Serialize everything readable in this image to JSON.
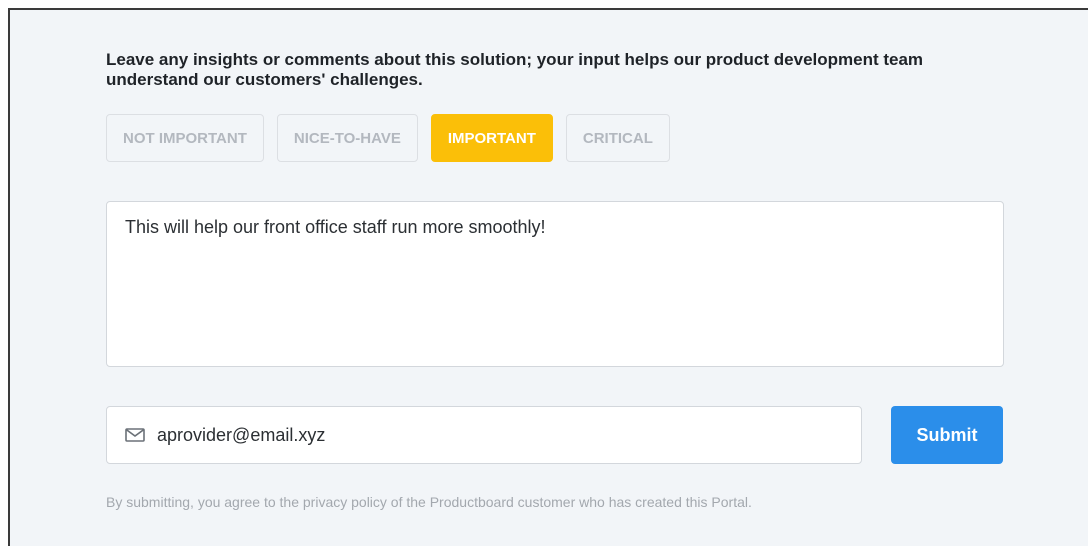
{
  "form": {
    "prompt": "Leave any insights or comments about this solution; your input helps our product development team understand our customers' challenges.",
    "importance_options": [
      {
        "label": "NOT IMPORTANT",
        "selected": false
      },
      {
        "label": "NICE-TO-HAVE",
        "selected": false
      },
      {
        "label": "IMPORTANT",
        "selected": true
      },
      {
        "label": "CRITICAL",
        "selected": false
      }
    ],
    "comment_value": "This will help our front office staff run more smoothly!",
    "email_value": "aprovider@email.xyz",
    "email_icon": "mail-icon",
    "submit_label": "Submit",
    "privacy_text": "By submitting, you agree to the privacy policy of the Productboard customer who has created this Portal."
  },
  "colors": {
    "selected_accent": "#fbbf08",
    "submit_accent": "#2b8eea",
    "panel_background": "#f2f5f8"
  }
}
